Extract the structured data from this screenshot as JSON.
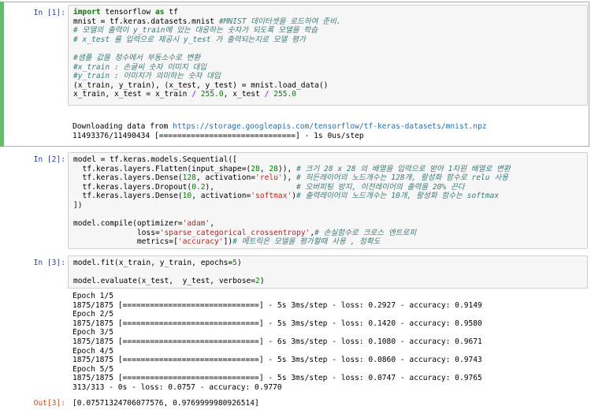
{
  "cell1": {
    "prompt": "In [1]:",
    "code": [
      [
        {
          "t": "import",
          "c": "kw"
        },
        {
          "t": " tensorflow "
        },
        {
          "t": "as",
          "c": "kw"
        },
        {
          "t": " tf"
        }
      ],
      [
        {
          "t": "mnist = tf.keras.datasets.mnist "
        },
        {
          "t": "#MNIST 데이터셋을 로드하여 준비.",
          "c": "cm"
        }
      ],
      [
        {
          "t": "# 모델의 출력이 y_train에 있는 대응하는 숫자가 되도록 모델을 학습",
          "c": "cm"
        }
      ],
      [
        {
          "t": "# x_test 를 입력으로 제공시 y_test 가 출력되는지로 모델 평가",
          "c": "cm"
        }
      ],
      [
        {
          "t": ""
        }
      ],
      [
        {
          "t": "#샘플 값을 정수에서 부동소수로 변환",
          "c": "cm"
        }
      ],
      [
        {
          "t": "#x_train : 손글씨 숫자 이미지 대입",
          "c": "cm"
        }
      ],
      [
        {
          "t": "#y_train : 이미지가 의미하는 숫자 대입",
          "c": "cm"
        }
      ],
      [
        {
          "t": "(x_train, y_train), (x_test, y_test) = mnist.load_data()"
        }
      ],
      [
        {
          "t": "x_train, x_test = x_train "
        },
        {
          "t": "/",
          "c": "op"
        },
        {
          "t": " "
        },
        {
          "t": "255.0",
          "c": "nu"
        },
        {
          "t": ", x_test "
        },
        {
          "t": "/",
          "c": "op"
        },
        {
          "t": " "
        },
        {
          "t": "255.0",
          "c": "nu"
        }
      ]
    ],
    "output_prefix": "Downloading data from ",
    "output_link": "https://storage.googleapis.com/tensorflow/tf-keras-datasets/mnist.npz",
    "output_progress": "11493376/11490434 [==============================] - 1s 0us/step"
  },
  "cell2": {
    "prompt": "In [2]:",
    "code": [
      [
        {
          "t": "model = tf.keras.models.Sequential(["
        }
      ],
      [
        {
          "t": "  tf.keras.layers.Flatten(input_shape=("
        },
        {
          "t": "28",
          "c": "nu"
        },
        {
          "t": ", "
        },
        {
          "t": "28",
          "c": "nu"
        },
        {
          "t": ")), "
        },
        {
          "t": "# 크기 28 x 28 의 배열을 입력으로 받아 1차원 배열로 변환",
          "c": "cm"
        }
      ],
      [
        {
          "t": "  tf.keras.layers.Dense("
        },
        {
          "t": "128",
          "c": "nu"
        },
        {
          "t": ", activation="
        },
        {
          "t": "'relu'",
          "c": "st"
        },
        {
          "t": "), "
        },
        {
          "t": "# 히든레이어의 노드개수는 128개, 활성화 함수로 relu 사용",
          "c": "cm"
        }
      ],
      [
        {
          "t": "  tf.keras.layers.Dropout("
        },
        {
          "t": "0.2",
          "c": "nu"
        },
        {
          "t": "),                  "
        },
        {
          "t": "# 오버피팅 방지, 이전레이어의 출력을 20% 끈다",
          "c": "cm"
        }
      ],
      [
        {
          "t": "  tf.keras.layers.Dense("
        },
        {
          "t": "10",
          "c": "nu"
        },
        {
          "t": ", activation="
        },
        {
          "t": "'softmax'",
          "c": "st"
        },
        {
          "t": ")"
        },
        {
          "t": "# 출력레이어의 노드개수는 10개, 활성화 함수는 softmax",
          "c": "cm"
        }
      ],
      [
        {
          "t": "])"
        }
      ],
      [
        {
          "t": ""
        }
      ],
      [
        {
          "t": "model.compile(optimizer="
        },
        {
          "t": "'adam'",
          "c": "st"
        },
        {
          "t": ","
        }
      ],
      [
        {
          "t": "              loss="
        },
        {
          "t": "'sparse_categorical_crossentropy'",
          "c": "st"
        },
        {
          "t": ","
        },
        {
          "t": "# 손실함수로 크로스 엔트로피",
          "c": "cm"
        }
      ],
      [
        {
          "t": "              metrics=["
        },
        {
          "t": "'accuracy'",
          "c": "st"
        },
        {
          "t": "])"
        },
        {
          "t": "# 메트릭은 모델을 평가할때 사용 , 정확도",
          "c": "cm"
        }
      ]
    ]
  },
  "cell3": {
    "prompt": "In [3]:",
    "code": [
      [
        {
          "t": "model.fit(x_train, y_train, epochs="
        },
        {
          "t": "5",
          "c": "nu"
        },
        {
          "t": ")"
        }
      ],
      [
        {
          "t": ""
        }
      ],
      [
        {
          "t": "model.evaluate(x_test,  y_test, verbose="
        },
        {
          "t": "2",
          "c": "nu"
        },
        {
          "t": ")"
        }
      ]
    ],
    "output_lines": [
      "Epoch 1/5",
      "1875/1875 [==============================] - 5s 3ms/step - loss: 0.2927 - accuracy: 0.9149",
      "Epoch 2/5",
      "1875/1875 [==============================] - 5s 3ms/step - loss: 0.1420 - accuracy: 0.9580",
      "Epoch 3/5",
      "1875/1875 [==============================] - 6s 3ms/step - loss: 0.1080 - accuracy: 0.9671",
      "Epoch 4/5",
      "1875/1875 [==============================] - 5s 3ms/step - loss: 0.0860 - accuracy: 0.9743",
      "Epoch 5/5",
      "1875/1875 [==============================] - 5s 3ms/step - loss: 0.0747 - accuracy: 0.9765",
      "313/313 - 0s - loss: 0.0757 - accuracy: 0.9770"
    ],
    "out_prompt": "Out[3]:",
    "out_value": "[0.07571324706077576, 0.9769999980926514]"
  }
}
